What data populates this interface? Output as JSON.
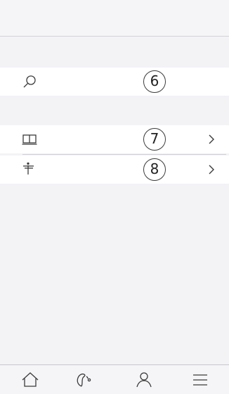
{
  "rows": [
    {
      "icon": "search-icon",
      "value": "6",
      "has_chevron": false
    },
    {
      "icon": "book-icon",
      "value": "7",
      "has_chevron": true
    },
    {
      "icon": "signpost-icon",
      "value": "8",
      "has_chevron": true
    }
  ],
  "tabbar": {
    "items": [
      {
        "icon": "home-icon"
      },
      {
        "icon": "hearing-icon"
      },
      {
        "icon": "person-icon"
      },
      {
        "icon": "menu-icon"
      }
    ]
  },
  "colors": {
    "background": "#f3f3f6",
    "row_background": "#ffffff",
    "icon": "#3a3a3a",
    "divider": "#cfcfd4"
  }
}
